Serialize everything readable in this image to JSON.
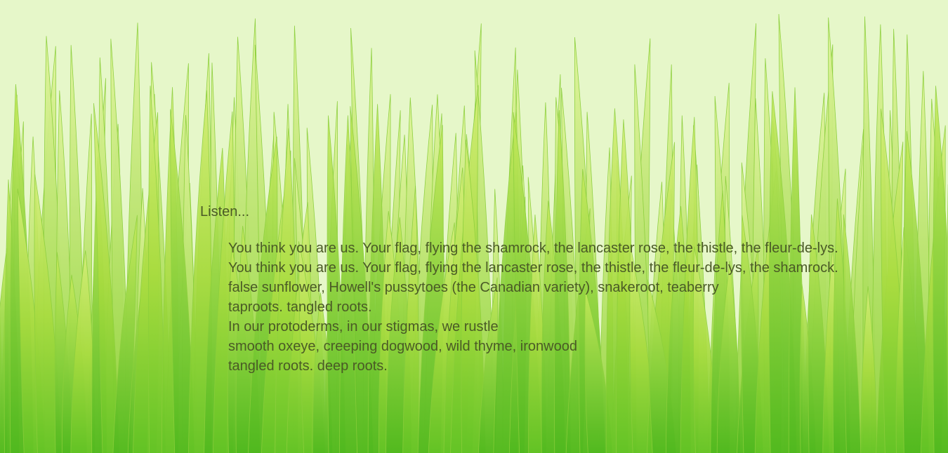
{
  "background": {
    "image": "grass-blades",
    "sky_color": "#e6f7c9",
    "grass_light": "#cbe85f",
    "grass_mid": "#9fd83a",
    "grass_dark": "#5fc025"
  },
  "poem": {
    "intro": "Listen...",
    "lines": [
      "You think you are us. Your flag, flying the shamrock, the lancaster rose, the thistle, the fleur-de-lys.",
      "You think you are us. Your flag, flying the lancaster rose, the thistle, the fleur-de-lys, the shamrock.",
      "false sunflower, Howell's pussytoes (the Canadian variety), snakeroot, teaberry",
      "taproots. tangled roots.",
      "In our protoderms, in our stigmas, we rustle",
      "smooth oxeye, creeping dogwood, wild thyme, ironwood",
      "tangled roots. deep roots."
    ]
  }
}
